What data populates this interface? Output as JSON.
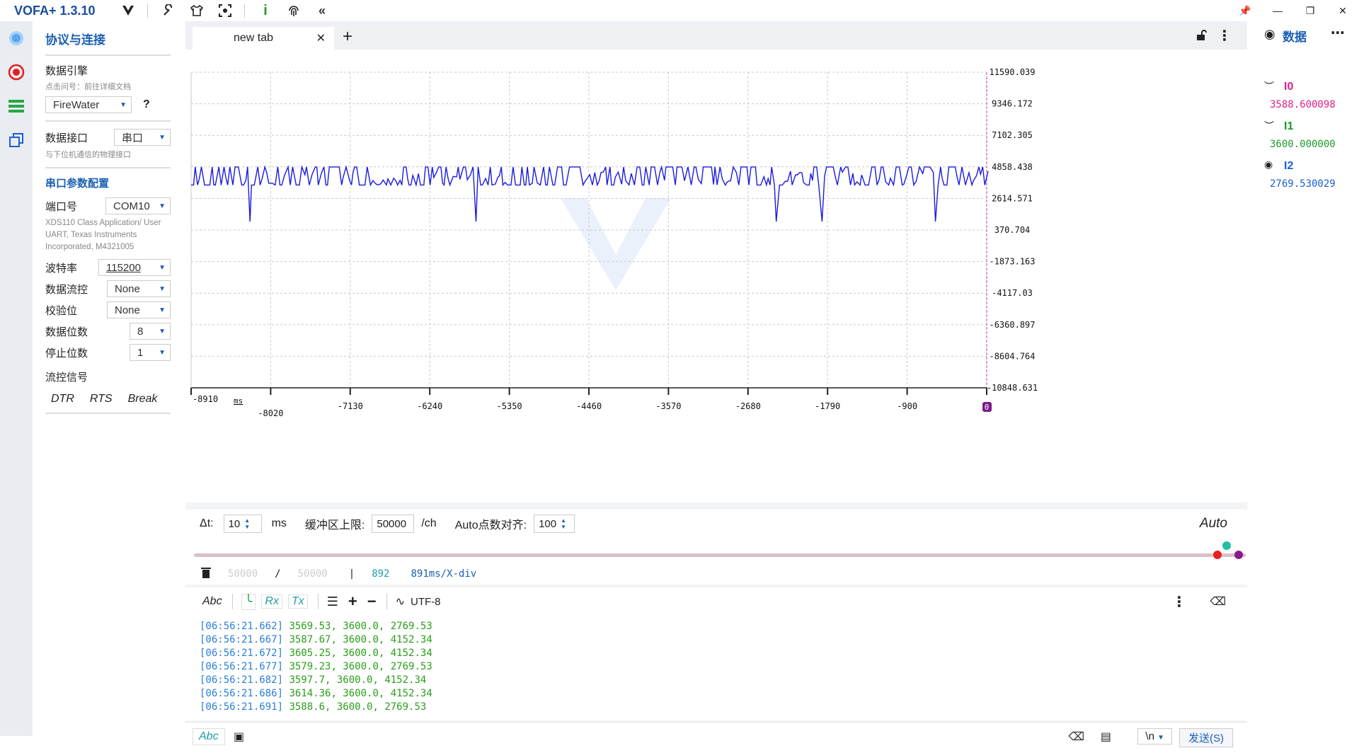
{
  "app": {
    "title": "VOFA+ 1.3.10"
  },
  "toolbar_icons": [
    "vofa-logo-icon",
    "wrench-icon",
    "shirt-icon",
    "screenshot-icon",
    "info-icon",
    "fingerprint-icon",
    "collapse-icon"
  ],
  "sidebar": {
    "title": "协议与连接",
    "engine_label": "数据引擎",
    "engine_hint": "点击问号：前往详细文档",
    "engine_value": "FireWater",
    "help": "?",
    "interface_label": "数据接口",
    "interface_value": "串口",
    "interface_hint": "与下位机通信的物理接口",
    "serial_section": "串口参数配置",
    "port_label": "端口号",
    "port_value": "COM10",
    "port_desc": "XDS110 Class Application/ User UART, Texas Instruments Incorporated, M4321005",
    "baud_label": "波特率",
    "baud_value": "115200",
    "flow_label": "数据流控",
    "flow_value": "None",
    "parity_label": "校验位",
    "parity_value": "None",
    "databits_label": "数据位数",
    "databits_value": "8",
    "stopbits_label": "停止位数",
    "stopbits_value": "1",
    "flowsig_label": "流控信号",
    "dtr": "DTR",
    "rts": "RTS",
    "break": "Break"
  },
  "tabs": [
    {
      "label": "new tab",
      "close": "✕"
    }
  ],
  "tab_add": "+",
  "chart_data": {
    "type": "line",
    "y_ticks": [
      "11590.039",
      "9346.172",
      "7102.305",
      "4858.438",
      "2614.571",
      "370.704",
      "-1873.163",
      "-4117.03",
      "-6360.897",
      "-8604.764",
      "-10848.631"
    ],
    "x_ticks": [
      "-8910",
      "-8020",
      "-7130",
      "-6240",
      "-5350",
      "-4460",
      "-3570",
      "-2680",
      "-1790",
      "-900",
      "0"
    ],
    "x_unit": "ms",
    "ylim": [
      -10848.631,
      11590.039
    ],
    "xlim": [
      -8910,
      0
    ],
    "series": [
      {
        "name": "I2",
        "color": "#1a1ae0",
        "values_min": 2614.571,
        "values_max": 4858.438,
        "typical": [
          2769.53,
          4152.34
        ]
      }
    ],
    "grid": true
  },
  "right_panel": {
    "title": "数据",
    "channels": [
      {
        "name": "I0",
        "value": "3588.600098",
        "color": "#e0218a"
      },
      {
        "name": "I1",
        "value": "3600.000000",
        "color": "#1f9a2a"
      },
      {
        "name": "I2",
        "value": "2769.530029",
        "color": "#1a5fd8"
      }
    ]
  },
  "controls": {
    "dt_label": "Δt:",
    "dt_value": "10",
    "dt_unit": "ms",
    "buffer_label": "缓冲区上限:",
    "buffer_value": "50000",
    "buffer_unit": "/ch",
    "auto_label": "Auto点数对齐:",
    "auto_value": "100",
    "auto_mode": "Auto"
  },
  "status": {
    "a": "50000",
    "sep1": "/",
    "b": "50000",
    "sep2": "|",
    "count": "892",
    "rate": "891ms/X-div"
  },
  "terminal_toolbar": {
    "abc": "Abc",
    "rx": "Rx",
    "tx": "Tx",
    "encoding": "UTF-8"
  },
  "terminal_lines": [
    {
      "ts": "[06:56:21.662]",
      "vals": "3569.53, 3600.0, 2769.53"
    },
    {
      "ts": "[06:56:21.667]",
      "vals": "3587.67, 3600.0, 4152.34"
    },
    {
      "ts": "[06:56:21.672]",
      "vals": "3605.25, 3600.0, 4152.34"
    },
    {
      "ts": "[06:56:21.677]",
      "vals": "3579.23, 3600.0, 2769.53"
    },
    {
      "ts": "[06:56:21.682]",
      "vals": "3597.7, 3600.0, 4152.34"
    },
    {
      "ts": "[06:56:21.686]",
      "vals": "3614.36, 3600.0, 4152.34"
    },
    {
      "ts": "[06:56:21.691]",
      "vals": "3588.6, 3600.0, 2769.53"
    }
  ],
  "sendbar": {
    "abc": "Abc",
    "newline": "\\n",
    "send": "发送(S)"
  }
}
